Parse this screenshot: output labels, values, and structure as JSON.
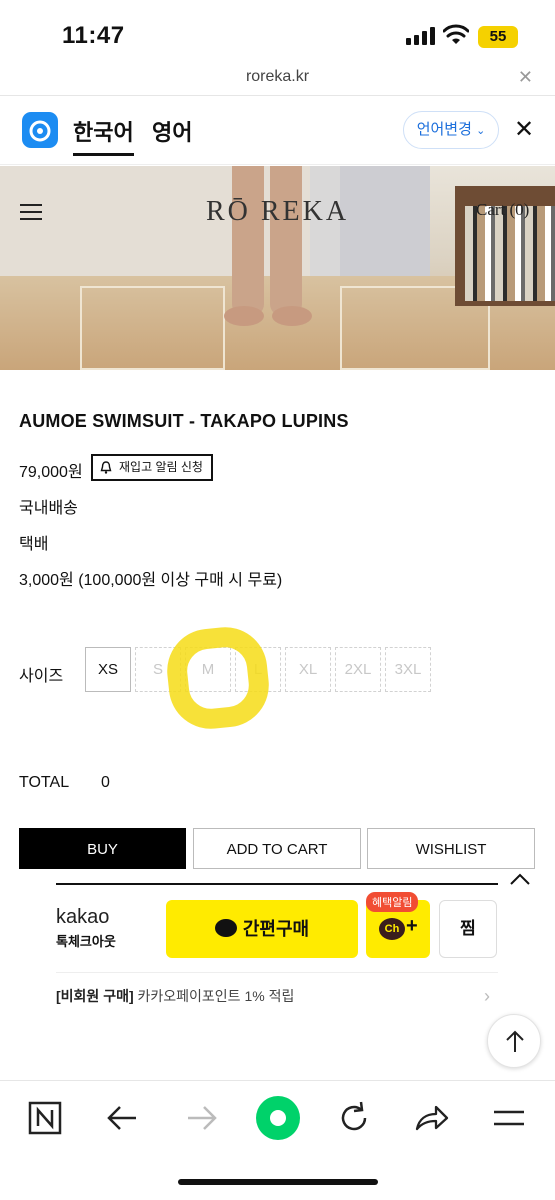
{
  "status": {
    "time": "11:47",
    "battery": "55"
  },
  "url": {
    "domain": "roreka.kr"
  },
  "translate": {
    "lang_source": "한국어",
    "lang_target": "영어",
    "change_label": "언어변경"
  },
  "site": {
    "brand": "RŌ REKA",
    "cart": "Cart (0)"
  },
  "product": {
    "title": "AUMOE SWIMSUIT - TAKAPO LUPINS",
    "price": "79,000원",
    "restock_label": "재입고 알림 신청",
    "shipping_region": "국내배송",
    "shipping_method": "택배",
    "shipping_fee": "3,000원 (100,000원 이상 구매 시 무료)"
  },
  "sizes": {
    "label": "사이즈",
    "options": [
      {
        "label": "XS",
        "available": true
      },
      {
        "label": "S",
        "available": false
      },
      {
        "label": "M",
        "available": false
      },
      {
        "label": "L",
        "available": false
      },
      {
        "label": "XL",
        "available": false
      },
      {
        "label": "2XL",
        "available": false
      },
      {
        "label": "3XL",
        "available": false
      }
    ]
  },
  "total": {
    "label": "TOTAL",
    "value": "0"
  },
  "actions": {
    "buy": "BUY",
    "add_to_cart": "ADD TO CART",
    "wishlist": "WISHLIST"
  },
  "kakao": {
    "logo": "kakao",
    "subtitle": "톡체크아웃",
    "pay_label": "간편구매",
    "channel_tag": "혜택알림",
    "channel_badge": "Ch",
    "channel_plus": "+",
    "zzim": "찜",
    "point_strong": "[비회원 구매]",
    "point_text": " 카카오페이포인트 1% 적립"
  },
  "colors": {
    "kakao_yellow": "#ffeb00",
    "highlight": "#f6dc16",
    "accent_blue": "#1c6fdc",
    "toolbar_green": "#00d26a"
  },
  "toolbar": {
    "icons": [
      "n-home-icon",
      "back-arrow-icon",
      "forward-arrow-icon",
      "green-dot-icon",
      "refresh-icon",
      "share-icon",
      "menu-icon"
    ]
  }
}
